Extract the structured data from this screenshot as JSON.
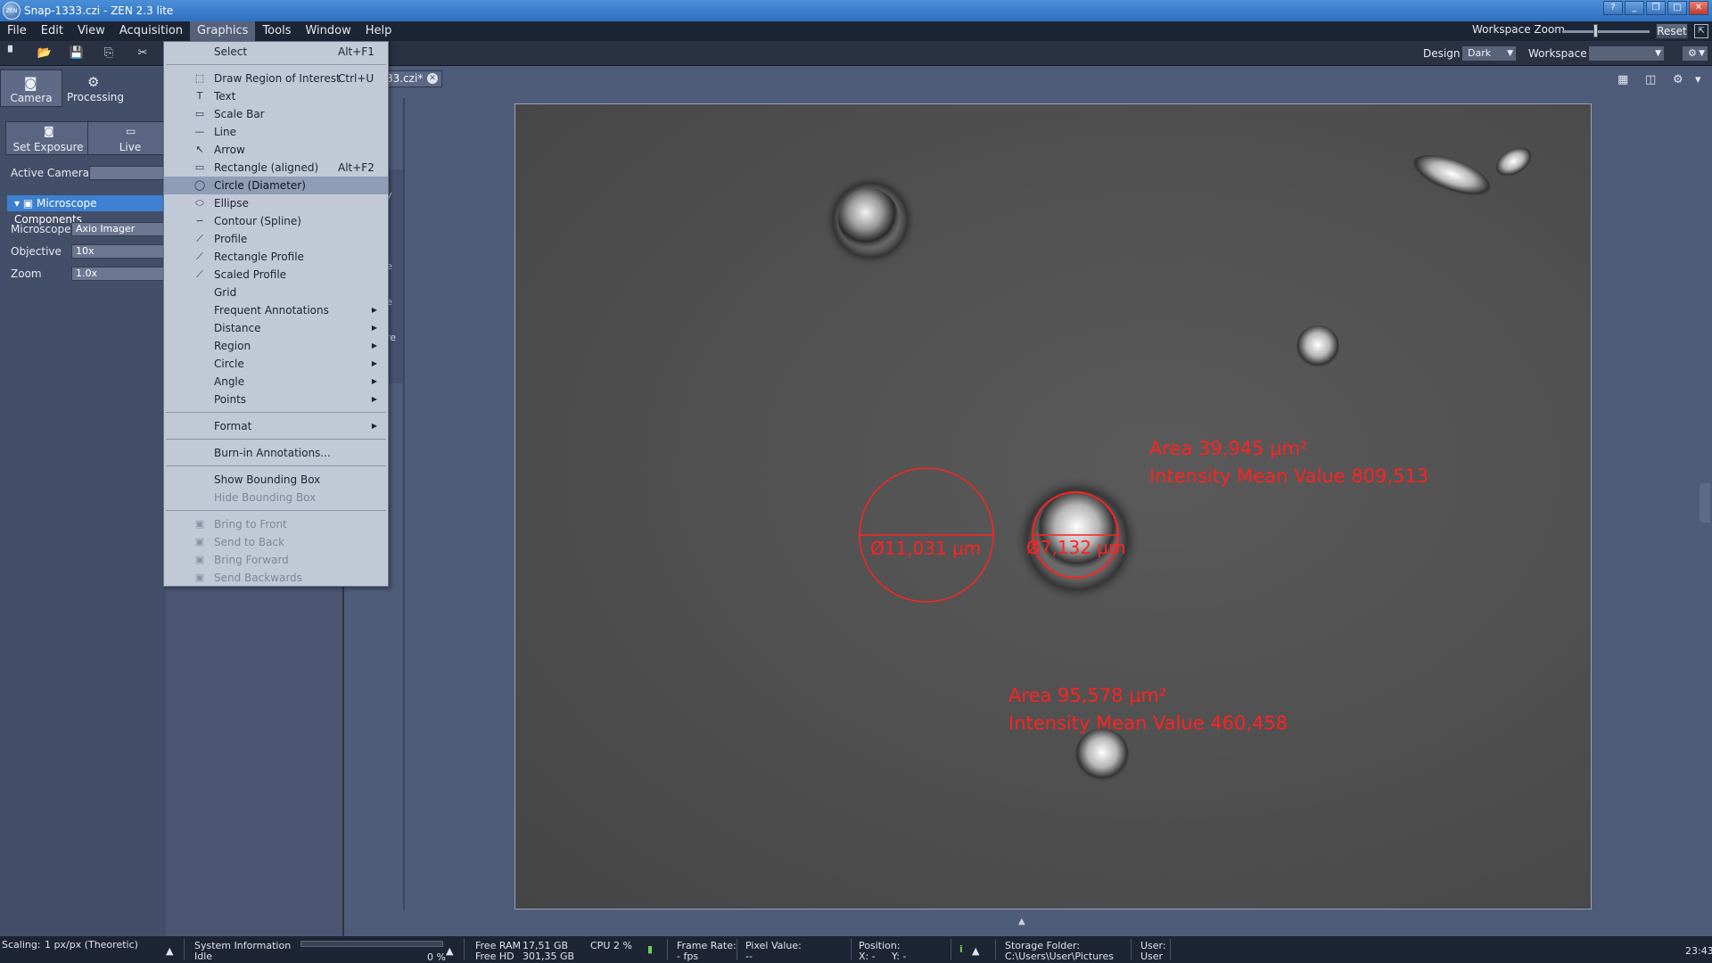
{
  "window": {
    "title": "Snap-1333.czi - ZEN 2.3 lite",
    "logo_text": "ZEN",
    "controls": [
      "?",
      "_",
      "❐",
      "□",
      "✕"
    ]
  },
  "menubar": {
    "items": [
      "File",
      "Edit",
      "View",
      "Acquisition",
      "Graphics",
      "Tools",
      "Window",
      "Help"
    ],
    "active": "Graphics",
    "workspace_zoom_label": "Workspace Zoom",
    "reset_label": "Reset"
  },
  "toolbar": {
    "design_label": "Design",
    "design_value": "Dark",
    "workspace_label": "Workspace",
    "workspace_value": ""
  },
  "left_panel": {
    "tabs": [
      {
        "label": "Camera",
        "icon": "camera-icon"
      },
      {
        "label": "Processing",
        "icon": "gear-icon"
      }
    ],
    "subtabs": [
      {
        "label": "Set Exposure",
        "icon": "camera-icon"
      },
      {
        "label": "Live",
        "icon": "monitor-icon"
      }
    ],
    "active_camera_label": "Active Camera",
    "section_title": "Microscope Components",
    "fields": [
      {
        "label": "Microscope",
        "value": "Axio Imager"
      },
      {
        "label": "Objective",
        "value": "10x"
      },
      {
        "label": "Zoom",
        "value": "1.0x"
      }
    ]
  },
  "document": {
    "tab_label": "33.czi*",
    "cut_letters": [
      "y",
      "e",
      "e",
      "re"
    ]
  },
  "graphics_menu": {
    "items": [
      {
        "label": "Select",
        "shortcut": "Alt+F1",
        "icon": ""
      },
      {
        "sep": true
      },
      {
        "label": "Draw Region of Interest",
        "shortcut": "Ctrl+U",
        "icon": "⬚"
      },
      {
        "label": "Text",
        "icon": "T"
      },
      {
        "label": "Scale Bar",
        "icon": "▭"
      },
      {
        "label": "Line",
        "icon": "—"
      },
      {
        "label": "Arrow",
        "icon": "↖"
      },
      {
        "label": "Rectangle (aligned)",
        "shortcut": "Alt+F2",
        "icon": "▭"
      },
      {
        "label": "Circle (Diameter)",
        "icon": "◯",
        "highlight": true
      },
      {
        "label": "Ellipse",
        "icon": "⬭"
      },
      {
        "label": "Contour (Spline)",
        "icon": "∽"
      },
      {
        "label": "Profile",
        "icon": "⟋"
      },
      {
        "label": "Rectangle Profile",
        "icon": "⟋"
      },
      {
        "label": "Scaled Profile",
        "icon": "⟋"
      },
      {
        "label": "Grid",
        "icon": ""
      },
      {
        "label": "Frequent Annotations",
        "submenu": true
      },
      {
        "label": "Distance",
        "submenu": true
      },
      {
        "label": "Region",
        "submenu": true
      },
      {
        "label": "Circle",
        "submenu": true
      },
      {
        "label": "Angle",
        "submenu": true
      },
      {
        "label": "Points",
        "submenu": true
      },
      {
        "sep": true
      },
      {
        "label": "Format",
        "submenu": true
      },
      {
        "sep": true
      },
      {
        "label": "Burn-in Annotations..."
      },
      {
        "sep": true
      },
      {
        "label": "Show Bounding Box"
      },
      {
        "label": "Hide Bounding Box",
        "disabled": true
      },
      {
        "sep": true
      },
      {
        "label": "Bring to Front",
        "disabled": true,
        "icon": "▣"
      },
      {
        "label": "Send to Back",
        "disabled": true,
        "icon": "▣"
      },
      {
        "label": "Bring Forward",
        "disabled": true,
        "icon": "▣"
      },
      {
        "label": "Send Backwards",
        "disabled": true,
        "icon": "▣"
      }
    ],
    "submenu_arrow": "▶"
  },
  "annotations": {
    "area1_line1": "Area 39,945 µm²",
    "area1_line2": "Intensity Mean Value 809,513",
    "area2_line1": "Area 95,578 µm²",
    "area2_line2": "Intensity Mean Value 460,458",
    "diam1": "Ø11,031 µm",
    "diam2": "Ø7,132 µm",
    "color": "#ff2222"
  },
  "statusbar": {
    "scaling_label": "Scaling:",
    "scaling_value": "1 px/px (Theoretic)",
    "sys_info_label": "System Information",
    "sys_info_value": "Idle",
    "progress_percent": 0,
    "progress_text": "0 %",
    "free_ram_label": "Free RAM",
    "free_ram_value": "17,51 GB",
    "free_hd_label": "Free HD",
    "free_hd_value": "301,35 GB",
    "cpu_label": "CPU",
    "cpu_value": "2 %",
    "frame_rate_label": "Frame Rate:",
    "frame_rate_value": "- fps",
    "pixel_value_label": "Pixel Value:",
    "pixel_value_value": "--",
    "position_label": "Position:",
    "position_x": "X: -",
    "position_y": "Y: -",
    "info_icon": "i",
    "storage_label": "Storage Folder:",
    "storage_value": "C:\\Users\\User\\Pictures",
    "user_label": "User:",
    "user_value": "User",
    "clock": "23:43"
  }
}
